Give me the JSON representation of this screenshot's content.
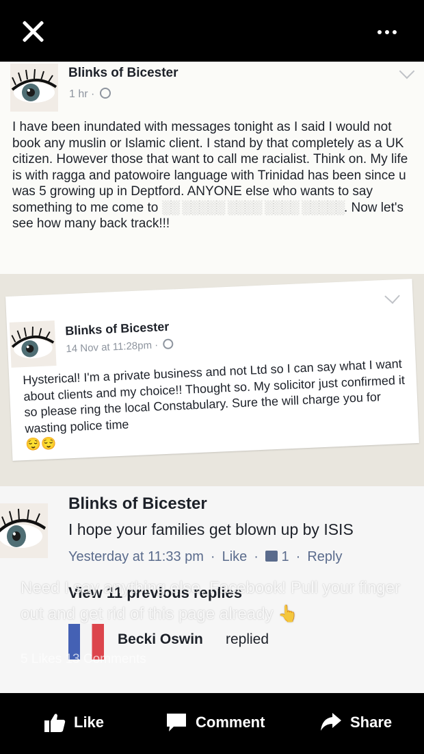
{
  "post1": {
    "author": "Blinks of Bicester",
    "time": "1 hr ·",
    "body": "I have been inundated with messages tonight as I said I would not book any muslin or Islamic client. I stand by that completely as a UK citizen. However those that want to call me racialist. Think on. My life is with ragga and patowoire language with Trinidad has been since u was 5 growing up in Deptford. ANYONE else who wants to say something to me come to",
    "redacted": "░░ ░░░░░ ░░░░ ░░░░ ░░░░░",
    "body_end": ". Now let's see how many back track!!!"
  },
  "post2": {
    "author": "Blinks of Bicester",
    "time": "14 Nov at 11:28pm ·",
    "body": "Hysterical! I'm a private business and not Ltd so I can say what I want about clients and my choice!! Thought so. My solicitor just confirmed it so please ring the local Constabulary. Sure the will charge you for wasting police time",
    "emoji": "😌😌"
  },
  "comment": {
    "author": "Blinks of Bicester",
    "text": "I hope your families get blown up by ISIS",
    "time": "Yesterday at 11:33 pm",
    "like": "Like",
    "like_count": "1",
    "reply": "Reply",
    "view_replies": "View 11 previous replies",
    "reply_author": "Becki Oswin",
    "reply_verb": "replied"
  },
  "overlay": {
    "caption": "Need I say anything else, Facebook! Pull your finger out and get rid of this page already 👆",
    "counts": "5 Likes 13 Comments"
  },
  "actions": {
    "like": "Like",
    "comment": "Comment",
    "share": "Share"
  },
  "colors": {
    "link_blue": "#5a6b8c",
    "text": "#1d2129",
    "background": "#000000"
  }
}
